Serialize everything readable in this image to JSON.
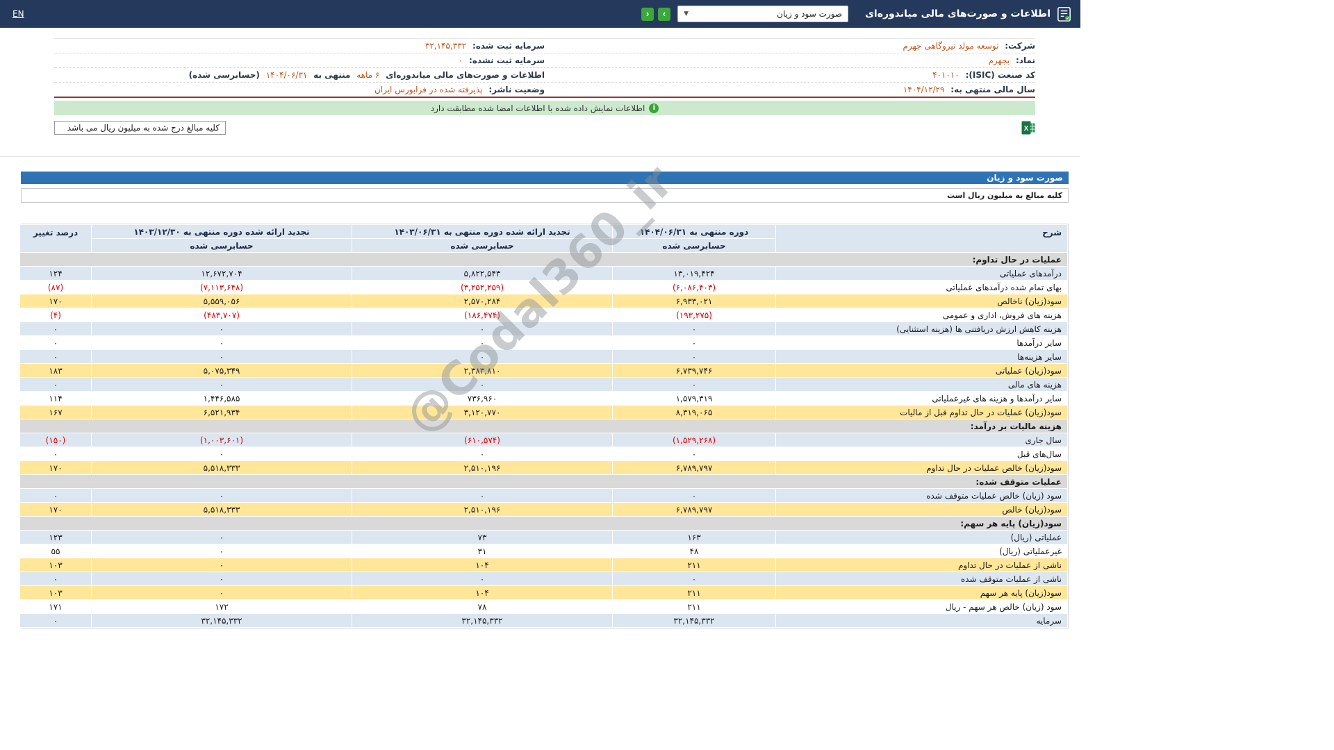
{
  "colors": {
    "topbar_bg": "#24395b",
    "statement_title_blue": "#2e74b5",
    "nav_button_green": "#3aa83a",
    "banner_green": "#cde9cd",
    "row_blue": "#dce6f1",
    "row_yellow": "#ffe699",
    "section_gray": "#d9d9d9",
    "negative_red": "#e00000",
    "info_value_orange": "#c0571a",
    "maroon_divider": "#943634"
  },
  "topbar": {
    "title": "اطلاعات و صورت‌های مالی میاندوره‌ای",
    "statement_select_value": "صورت سود و زیان",
    "next_button_glyph": "›",
    "prev_button_glyph": "‹",
    "en_label": "EN"
  },
  "company_info": {
    "company_label": "شرکت:",
    "company_value": "توسعه مولد نیروگاهی جهرم",
    "registered_capital_label": "سرمایه ثبت شده:",
    "registered_capital_value": "۳۲,۱۴۵,۳۳۲",
    "symbol_label": "نماد:",
    "symbol_value": "بجهرم",
    "unregistered_capital_label": "سرمایه ثبت نشده:",
    "unregistered_capital_value": "۰",
    "isic_label": "کد صنعت (ISIC):",
    "isic_value": "۴۰۱۰۱۰",
    "period_prefix": "اطلاعات و صورت‌های مالی میاندوره‌ای",
    "period_duration": "۶ ماهه",
    "period_middle": "منتهی به",
    "period_date": "۱۴۰۴/۰۶/۳۱",
    "period_suffix": "(حسابرسی شده)",
    "fiscal_year_label": "سال مالی منتهی به:",
    "fiscal_year_value": "۱۴۰۴/۱۲/۲۹",
    "publisher_status_label": "وضعیت ناشر:",
    "publisher_status_value": "پذیرفته شده در فرابورس ایران"
  },
  "signature_banner": {
    "text": "اطلاعات نمایش داده شده با اطلاعات امضا شده مطابقت دارد",
    "icon_glyph": "i"
  },
  "amounts_note_box": {
    "text": "کلیه مبالغ درج شده به میلیون ریال می باشد"
  },
  "statement": {
    "title": "صورت سود و زیان",
    "amounts_note": "کلیه مبالغ به میلیون ریال است",
    "header": {
      "description": "شرح",
      "current_period": "دوره منتهی به ۱۴۰۴/۰۶/۳۱",
      "restated_prior_midyear": "تجدید ارائه شده دوره منتهی به ۱۴۰۳/۰۶/۳۱",
      "restated_prior_yearend": "تجدید ارائه شده دوره منتهی به ۱۴۰۳/۱۲/۳۰",
      "audited": "حسابرسی شده",
      "change_percent": "درصد تغییر"
    },
    "rows": [
      {
        "type": "section",
        "label": "عملیات در حال تداوم:"
      },
      {
        "type": "data",
        "style": "blue",
        "label": "درآمدهای عملیاتی",
        "values": [
          "۱۳,۰۱۹,۴۲۴",
          "۵,۸۲۲,۵۴۳",
          "۱۲,۶۷۲,۷۰۴",
          "۱۲۴"
        ]
      },
      {
        "type": "data",
        "style": "white",
        "label": "بهای تمام شده درآمدهای عملیاتی",
        "values": [
          "(۶,۰۸۶,۴۰۳)",
          "(۳,۲۵۲,۲۵۹)",
          "(۷,۱۱۳,۶۴۸)",
          "(۸۷)"
        ]
      },
      {
        "type": "data",
        "style": "yellow",
        "label": "سود(زیان) ناخالص",
        "values": [
          "۶,۹۳۳,۰۲۱",
          "۲,۵۷۰,۲۸۴",
          "۵,۵۵۹,۰۵۶",
          "۱۷۰"
        ]
      },
      {
        "type": "data",
        "style": "white",
        "label": "هزینه های فروش، اداری و عمومی",
        "values": [
          "(۱۹۳,۲۷۵)",
          "(۱۸۶,۴۷۴)",
          "(۴۸۳,۷۰۷)",
          "(۴)"
        ]
      },
      {
        "type": "data",
        "style": "blue",
        "label": "هزینه کاهش ارزش دریافتنی ها (هزینه استثنایی)",
        "values": [
          "۰",
          "۰",
          "۰",
          "۰"
        ]
      },
      {
        "type": "data",
        "style": "white",
        "label": "سایر درآمدها",
        "values": [
          "۰",
          "۰",
          "۰",
          "۰"
        ]
      },
      {
        "type": "data",
        "style": "blue",
        "label": "سایر هزینه‌ها",
        "values": [
          "۰",
          "۰",
          "۰",
          "۰"
        ]
      },
      {
        "type": "data",
        "style": "yellow",
        "label": "سود(زیان) عملیاتی",
        "values": [
          "۶,۷۳۹,۷۴۶",
          "۲,۳۸۳,۸۱۰",
          "۵,۰۷۵,۳۴۹",
          "۱۸۳"
        ]
      },
      {
        "type": "data",
        "style": "blue",
        "label": "هزینه های مالی",
        "values": [
          "۰",
          "۰",
          "۰",
          "۰"
        ]
      },
      {
        "type": "data",
        "style": "white",
        "label": "سایر درآمدها و هزینه های غیرعملیاتی",
        "values": [
          "۱,۵۷۹,۳۱۹",
          "۷۳۶,۹۶۰",
          "۱,۴۴۶,۵۸۵",
          "۱۱۴"
        ]
      },
      {
        "type": "data",
        "style": "yellow",
        "label": "سود(زیان) عملیات در حال تداوم قبل از مالیات",
        "values": [
          "۸,۳۱۹,۰۶۵",
          "۳,۱۲۰,۷۷۰",
          "۶,۵۲۱,۹۳۴",
          "۱۶۷"
        ]
      },
      {
        "type": "section",
        "label": "هزینه مالیات بر درآمد:"
      },
      {
        "type": "data",
        "style": "blue",
        "label": "سال جاری",
        "values": [
          "(۱,۵۲۹,۲۶۸)",
          "(۶۱۰,۵۷۴)",
          "(۱,۰۰۳,۶۰۱)",
          "(۱۵۰)"
        ]
      },
      {
        "type": "data",
        "style": "white",
        "label": "سال‌های قبل",
        "values": [
          "۰",
          "۰",
          "۰",
          "۰"
        ]
      },
      {
        "type": "data",
        "style": "yellow",
        "label": "سود(زیان) خالص عملیات در حال تداوم",
        "values": [
          "۶,۷۸۹,۷۹۷",
          "۲,۵۱۰,۱۹۶",
          "۵,۵۱۸,۳۳۳",
          "۱۷۰"
        ]
      },
      {
        "type": "section",
        "label": "عملیات متوقف شده:"
      },
      {
        "type": "data",
        "style": "blue",
        "label": "سود (زیان) خالص عملیات متوقف شده",
        "values": [
          "۰",
          "۰",
          "۰",
          "۰"
        ]
      },
      {
        "type": "data",
        "style": "yellow",
        "label": "سود(زیان) خالص",
        "values": [
          "۶,۷۸۹,۷۹۷",
          "۲,۵۱۰,۱۹۶",
          "۵,۵۱۸,۳۳۳",
          "۱۷۰"
        ]
      },
      {
        "type": "section",
        "label": "سود(زیان) پایه هر سهم:"
      },
      {
        "type": "data",
        "style": "blue",
        "label": "عملیاتی (ریال)",
        "values": [
          "۱۶۳",
          "۷۳",
          "۰",
          "۱۲۳"
        ]
      },
      {
        "type": "data",
        "style": "white",
        "label": "غیرعملیاتی (ریال)",
        "values": [
          "۴۸",
          "۳۱",
          "۰",
          "۵۵"
        ]
      },
      {
        "type": "data",
        "style": "yellow",
        "label": "ناشی از عملیات در حال تداوم",
        "values": [
          "۲۱۱",
          "۱۰۴",
          "۰",
          "۱۰۳"
        ]
      },
      {
        "type": "data",
        "style": "blue",
        "label": "ناشی از عملیات متوقف شده",
        "values": [
          "۰",
          "۰",
          "۰",
          "۰"
        ]
      },
      {
        "type": "data",
        "style": "yellow",
        "label": "سود(زیان) پایه هر سهم",
        "values": [
          "۲۱۱",
          "۱۰۴",
          "۰",
          "۱۰۳"
        ]
      },
      {
        "type": "data",
        "style": "white",
        "label": "سود (زیان) خالص هر سهم - ریال",
        "values": [
          "۲۱۱",
          "۷۸",
          "۱۷۲",
          "۱۷۱"
        ]
      },
      {
        "type": "data",
        "style": "blue",
        "label": "سرمایه",
        "values": [
          "۳۲,۱۴۵,۳۳۲",
          "۳۲,۱۴۵,۳۳۲",
          "۳۲,۱۴۵,۳۳۲",
          "۰"
        ]
      }
    ]
  },
  "watermark": {
    "text": "@Codal360_ir"
  }
}
